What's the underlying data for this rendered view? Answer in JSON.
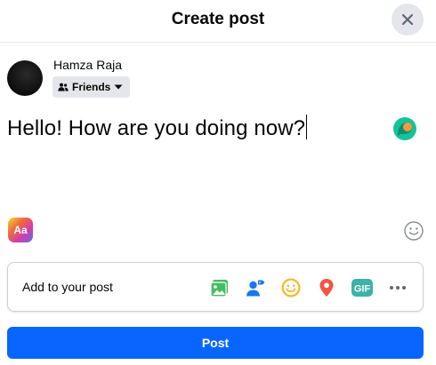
{
  "dialog": {
    "title": "Create post",
    "close_icon": "close-icon"
  },
  "author": {
    "name": "Hamza Raja",
    "audience": "Friends",
    "audience_icon": "friends-icon",
    "dropdown_icon": "caret-down-icon"
  },
  "composer": {
    "text": "Hello! How are you doing now?",
    "grammarly_icon": "grammarly-icon",
    "background_picker_label": "Aa",
    "emoji_icon": "smiley-icon"
  },
  "add_to_post": {
    "label": "Add to your post",
    "icons": [
      {
        "name": "photo-video-icon",
        "color": "#45bd62"
      },
      {
        "name": "tag-people-icon",
        "color": "#1877f2"
      },
      {
        "name": "feeling-activity-icon",
        "color": "#f7b928"
      },
      {
        "name": "check-in-icon",
        "color": "#f5533d"
      },
      {
        "name": "gif-icon",
        "color": "#3bb4a6"
      },
      {
        "name": "more-icon",
        "color": "#65676b"
      }
    ]
  },
  "submit": {
    "label": "Post",
    "color": "#0866ff"
  }
}
